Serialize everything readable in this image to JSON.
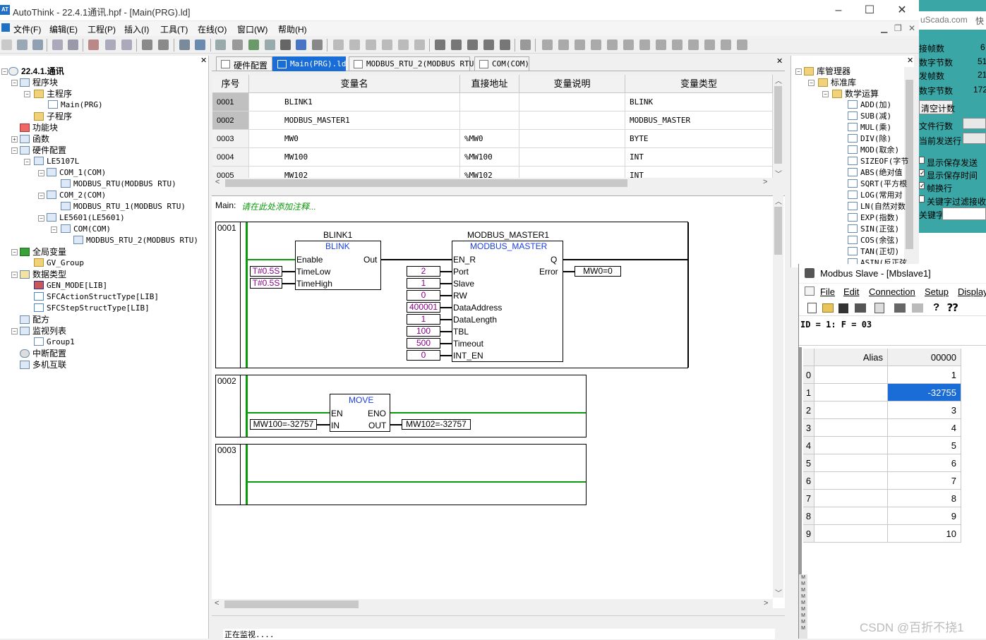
{
  "window": {
    "title": "AutoThink - 22.4.1通讯.hpf - [Main(PRG).ld]",
    "icon": "AT"
  },
  "menu": [
    "文件(F)",
    "编辑(E)",
    "工程(P)",
    "插入(I)",
    "工具(T)",
    "在线(O)",
    "窗口(W)",
    "帮助(H)"
  ],
  "tree": {
    "root": "22.4.1.通讯",
    "items": [
      "程序块",
      "主程序",
      "Main(PRG)",
      "子程序",
      "功能块",
      "函数",
      "硬件配置",
      "LE5107L",
      "COM_1(COM)",
      "MODBUS_RTU(MODBUS RTU)",
      "COM_2(COM)",
      "MODBUS_RTU_1(MODBUS RTU)",
      "LE5601(LE5601)",
      "COM(COM)",
      "MODBUS_RTU_2(MODBUS RTU)",
      "全局变量",
      "GV_Group",
      "数据类型",
      "GEN_MODE[LIB]",
      "SFCActionStructType[LIB]",
      "SFCStepStructType[LIB]",
      "配方",
      "监视列表",
      "Group1",
      "中断配置",
      "多机互联"
    ]
  },
  "tabs": [
    "硬件配置",
    "Main(PRG).ld",
    "MODBUS_RTU_2(MODBUS RTU)",
    "COM(COM)"
  ],
  "vartable": {
    "headers": [
      "序号",
      "变量名",
      "直接地址",
      "变量说明",
      "变量类型"
    ],
    "rows": [
      {
        "no": "0001",
        "name": "BLINK1",
        "addr": "",
        "desc": "",
        "type": "BLINK"
      },
      {
        "no": "0002",
        "name": "MODBUS_MASTER1",
        "addr": "",
        "desc": "",
        "type": "MODBUS_MASTER"
      },
      {
        "no": "0003",
        "name": "MW0",
        "addr": "%MW0",
        "desc": "",
        "type": "BYTE"
      },
      {
        "no": "0004",
        "name": "MW100",
        "addr": "%MW100",
        "desc": "",
        "type": "INT"
      },
      {
        "no": "0005",
        "name": "MW102",
        "addr": "%MW102",
        "desc": "",
        "type": "INT"
      }
    ]
  },
  "editor": {
    "header_label": "Main:",
    "comment": "请在此处添加注释...",
    "rungs": [
      "0001",
      "0002",
      "0003"
    ],
    "blink": {
      "instance": "BLINK1",
      "type": "BLINK",
      "in1": "Enable",
      "in2": "TimeLow",
      "in3": "TimeHigh",
      "out": "Out",
      "c1": "T#0.5S",
      "c2": "T#0.5S"
    },
    "modbus": {
      "instance": "MODBUS_MASTER1",
      "type": "MODBUS_MASTER",
      "pins": [
        "EN_R",
        "Port",
        "Slave",
        "RW",
        "DataAddress",
        "DataLength",
        "TBL",
        "Timeout",
        "INT_EN"
      ],
      "vals": [
        "2",
        "1",
        "0",
        "400001",
        "1",
        "100",
        "500",
        "0"
      ],
      "outQ": "Q",
      "outErr": "Error",
      "errval": "MW0=0"
    },
    "move": {
      "type": "MOVE",
      "en": "EN",
      "eno": "ENO",
      "in": "IN",
      "out": "OUT",
      "inval": "MW100=-32757",
      "outval": "MW102=-32757"
    }
  },
  "status": "正在监视....",
  "library": {
    "items": [
      "库管理器",
      "标准库",
      "数学运算",
      "ADD(加)",
      "SUB(减)",
      "MUL(乘)",
      "DIV(除)",
      "MOD(取余)",
      "SIZEOF(字节",
      "ABS(绝对值",
      "SQRT(平方根",
      "LOG(常用对",
      "LN(自然对数",
      "EXP(指数)",
      "SIN(正弦)",
      "COS(余弦)",
      "TAN(正切)",
      "ASIN(反正弦"
    ]
  },
  "bgapp": {
    "url": "uScada.com",
    "tab": "快",
    "labels": [
      "接帧数",
      "数字节数",
      "发帧数",
      "数字节数",
      "清空计数",
      "文件行数",
      "当前发送行",
      "显示保存发送",
      "显示保存时间",
      "帧换行",
      "关键字过滤接收",
      "关键字"
    ],
    "values": [
      "6",
      "51",
      "21",
      "172"
    ]
  },
  "modbus_slave": {
    "title": "Modbus Slave - [Mbslave1]",
    "menu": [
      "File",
      "Edit",
      "Connection",
      "Setup",
      "Display"
    ],
    "id_line": "ID = 1: F = 03",
    "headers": [
      "Alias",
      "00000"
    ],
    "rows": [
      {
        "i": "0",
        "v": "1"
      },
      {
        "i": "1",
        "v": "-32755"
      },
      {
        "i": "2",
        "v": "3"
      },
      {
        "i": "3",
        "v": "4"
      },
      {
        "i": "4",
        "v": "5"
      },
      {
        "i": "5",
        "v": "6"
      },
      {
        "i": "6",
        "v": "7"
      },
      {
        "i": "7",
        "v": "8"
      },
      {
        "i": "8",
        "v": "9"
      },
      {
        "i": "9",
        "v": "10"
      }
    ]
  },
  "watermark": "CSDN @百折不挠1",
  "colors": {
    "accent": "#1a6dd6",
    "rail": "#0a9a0a",
    "const": "#8b008b",
    "fb_type": "#1a3ee0",
    "comment": "#0a9a0a"
  }
}
